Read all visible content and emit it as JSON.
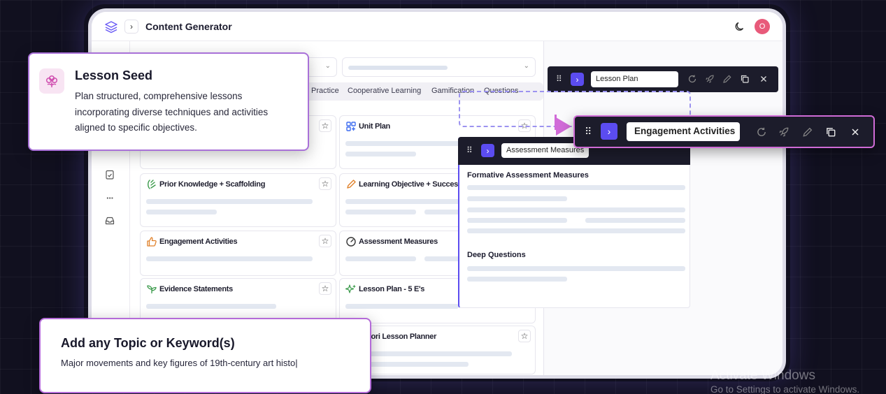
{
  "app": {
    "title": "Content Generator",
    "avatar_initial": "O",
    "accent": "#5b4cf0",
    "highlight": "#cf6bd6"
  },
  "tabs": [
    "Practice",
    "Cooperative Learning",
    "Gamification",
    "Questions"
  ],
  "cards": [
    {
      "title": "Unit Plan",
      "icon": "unit-plan-icon"
    },
    {
      "title": "Prior Knowledge + Scaffolding",
      "icon": "scaffolding-icon"
    },
    {
      "title": "Learning Objective + Success Criteria",
      "icon": "pencil-icon"
    },
    {
      "title": "Engagement Activities",
      "icon": "thumbs-up-icon"
    },
    {
      "title": "Assessment Measures",
      "icon": "gauge-icon"
    },
    {
      "title": "Evidence Statements",
      "icon": "sprout-icon"
    },
    {
      "title": "Lesson Plan - 5 E's",
      "icon": "sparkles-icon"
    },
    {
      "title": "essori Lesson Planner",
      "icon": ""
    }
  ],
  "right_panel": {
    "lesson_plan_chip": "Lesson Plan",
    "assessment_chip": "Assessment Measures",
    "sections": [
      "Formative Assessment Measures",
      "Deep Questions"
    ]
  },
  "popout": {
    "label": "Engagement Activities"
  },
  "seed": {
    "title": "Lesson Seed",
    "description": "Plan structured, comprehensive lessons incorporating diverse techniques and activities aligned to specific objectives."
  },
  "topic": {
    "title": "Add any Topic or Keyword(s)",
    "input_value": "Major movements and key figures of 19th-century art histo|"
  },
  "watermark": {
    "line1": "Activate Windows",
    "line2": "Go to Settings to activate Windows."
  }
}
